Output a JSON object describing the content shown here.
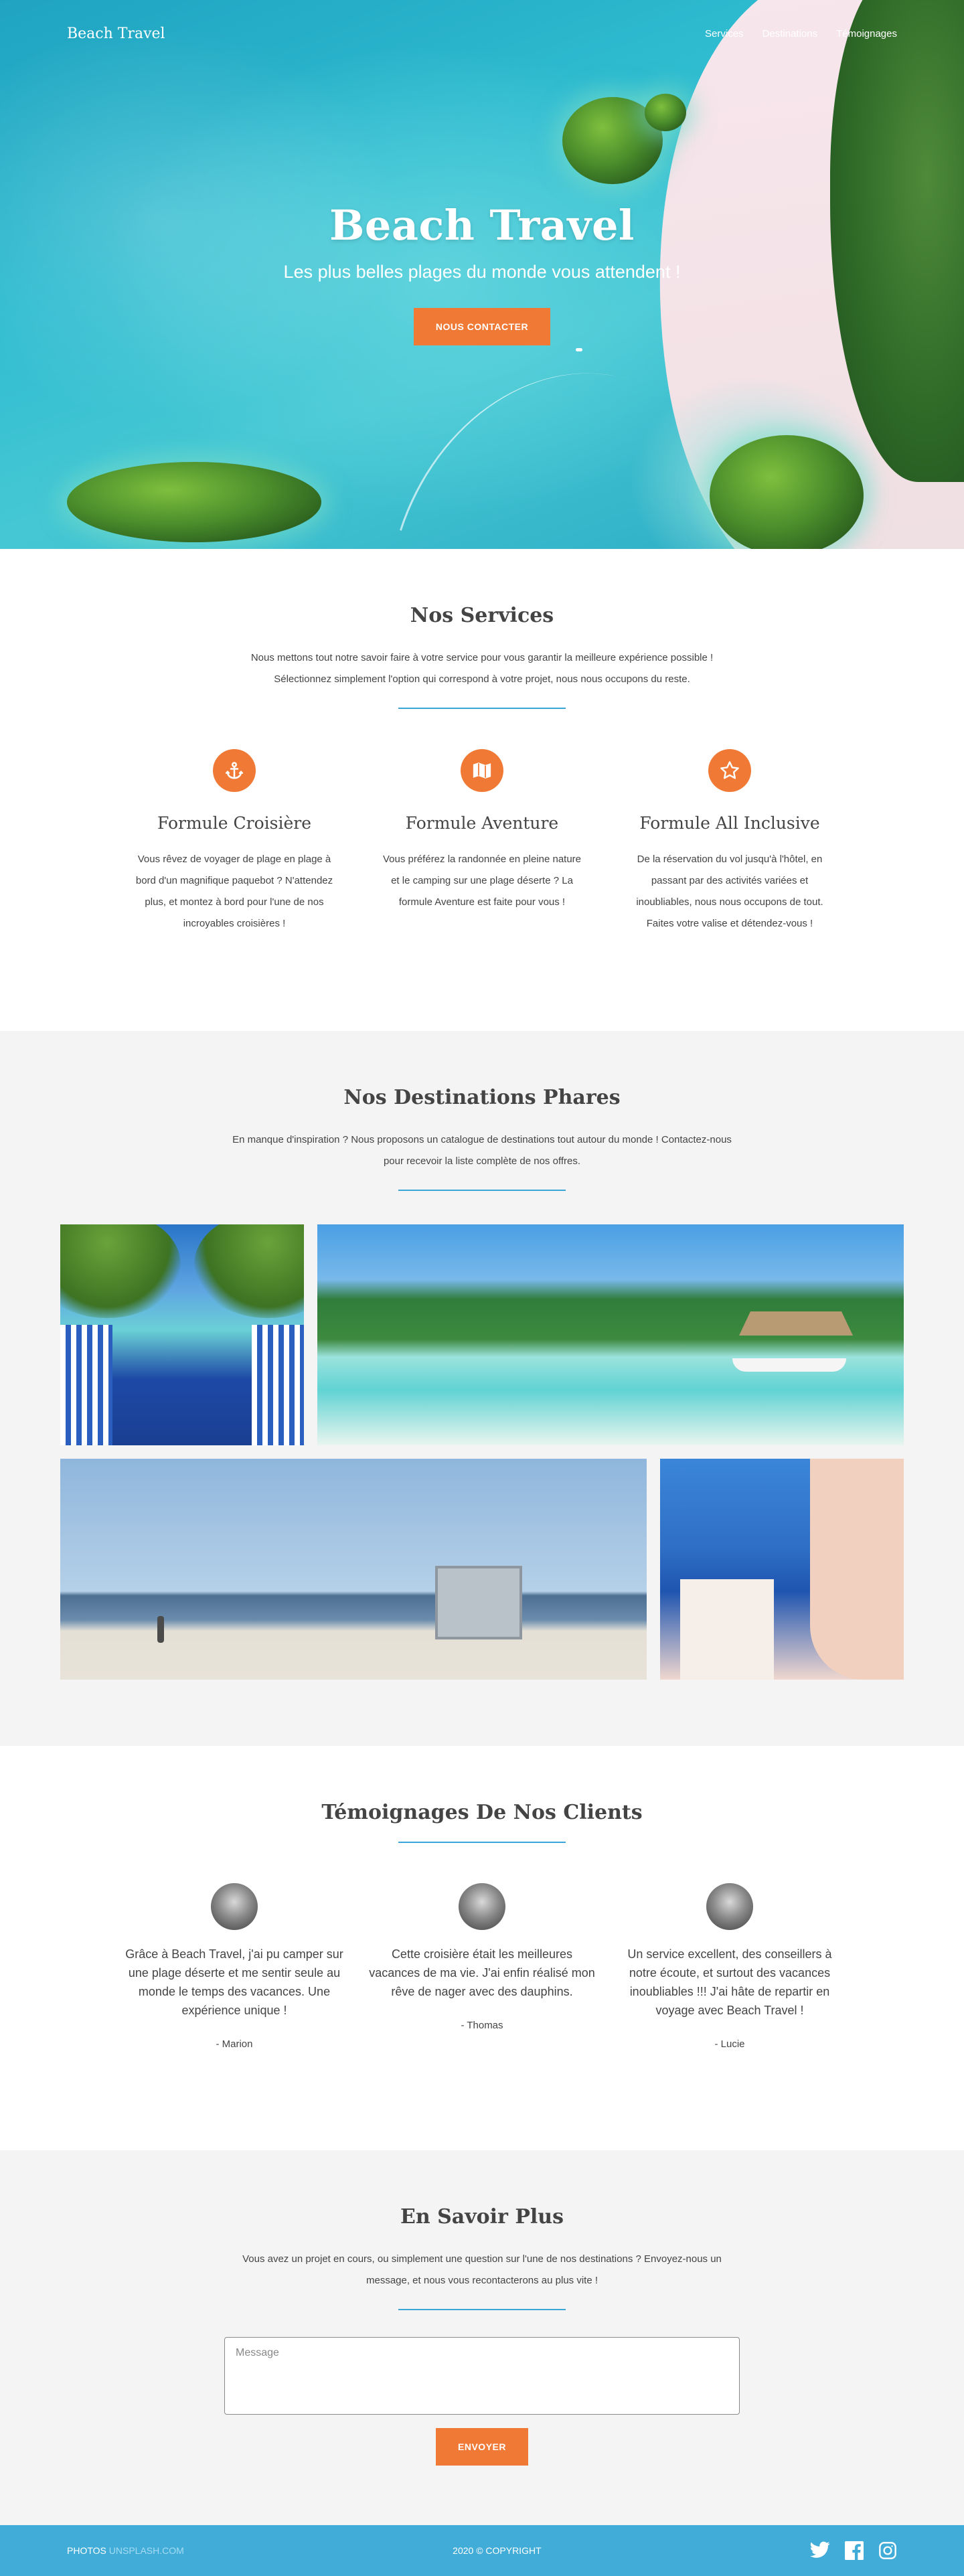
{
  "nav": {
    "brand": "Beach Travel",
    "links": [
      "Services",
      "Destinations",
      "Témoignages"
    ]
  },
  "hero": {
    "title": "Beach Travel",
    "subtitle": "Les plus belles plages du monde vous attendent !",
    "cta": "Nous contacter"
  },
  "services": {
    "title": "Nos Services",
    "intro": "Nous mettons tout notre savoir faire à votre service pour vous garantir la meilleure expérience possible ! Sélectionnez simplement l'option qui correspond à votre projet, nous nous occupons du reste.",
    "items": [
      {
        "icon": "anchor-icon",
        "title": "Formule Croisière",
        "text": "Vous rêvez de voyager de plage en plage à bord d'un magnifique paquebot ? N'attendez plus, et montez à bord pour l'une de nos incroyables croisières !"
      },
      {
        "icon": "map-icon",
        "title": "Formule Aventure",
        "text": "Vous préférez la randonnée en pleine nature et le camping sur une plage déserte ? La formule Aventure est faite pour vous !"
      },
      {
        "icon": "star-icon",
        "title": "Formule All Inclusive",
        "text": "De la réservation du vol jusqu'à l'hôtel, en passant par des activités variées et inoubliables, nous nous occupons de tout. Faites votre valise et détendez-vous !"
      }
    ]
  },
  "destinations": {
    "title": "Nos Destinations Phares",
    "intro": "En manque d'inspiration ? Nous proposons un catalogue de destinations tout autour du monde ! Contactez-nous pour recevoir la liste complète de nos offres."
  },
  "testimonials": {
    "title": "Témoignages De Nos Clients",
    "items": [
      {
        "text": "Grâce à Beach Travel, j'ai pu camper sur une plage déserte et me sentir seule au monde le temps des vacances. Une expérience unique !",
        "author": "- Marion"
      },
      {
        "text": "Cette croisière était les meilleures vacances de ma vie. J'ai enfin réalisé mon rêve de nager avec des dauphins.",
        "author": "- Thomas"
      },
      {
        "text": "Un service excellent, des conseillers à notre écoute, et surtout des vacances inoubliables !!! J'ai hâte de repartir en voyage avec Beach Travel !",
        "author": "- Lucie"
      }
    ]
  },
  "contact": {
    "title": "En Savoir Plus",
    "intro": "Vous avez un projet en cours, ou simplement une question sur l'une de nos destinations ? Envoyez-nous un message, et nous vous recontacterons au plus vite !",
    "placeholder": "Message",
    "button": "Envoyer"
  },
  "footer": {
    "credit_prefix": "PHOTOS",
    "credit_link": "UNSPLASH.COM",
    "copyright": "2020 © COPYRIGHT",
    "social": [
      "twitter-icon",
      "facebook-icon",
      "instagram-icon"
    ]
  },
  "colors": {
    "accent_orange": "#f07a35",
    "accent_blue": "#3aa7d8",
    "footer_blue": "#42acd9"
  }
}
